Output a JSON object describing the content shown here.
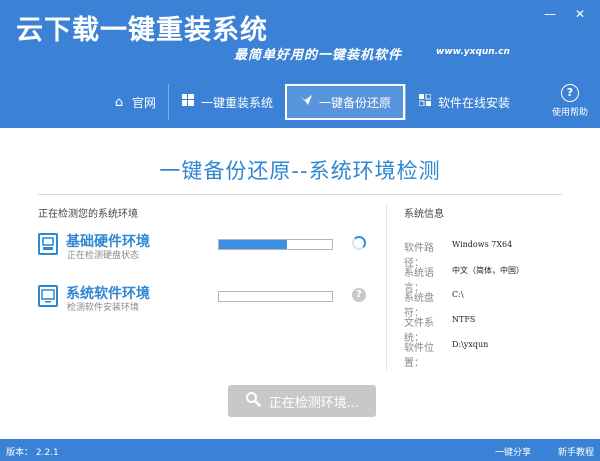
{
  "app": {
    "title": "云下载一键重装系统",
    "slogan": "最简单好用的一键装机软件",
    "site": "www.yxqun.cn"
  },
  "window_controls": {
    "minimize": "—",
    "close": "✕"
  },
  "tabs": [
    {
      "label": "官网",
      "icon": "home-icon"
    },
    {
      "label": "一键重装系统",
      "icon": "windows-icon"
    },
    {
      "label": "一键备份还原",
      "icon": "bird-icon",
      "active": true
    },
    {
      "label": "软件在线安装",
      "icon": "package-icon"
    }
  ],
  "help": {
    "label": "使用帮助",
    "icon": "?"
  },
  "main": {
    "title": "一键备份还原--系统环境检测",
    "left_section_title": "正在检测您的系统环境",
    "right_section_title": "系统信息",
    "checks": [
      {
        "title": "基础硬件环境",
        "subtitle": "正在检测硬盘状态",
        "progress": 0.6,
        "status": "loading"
      },
      {
        "title": "系统软件环境",
        "subtitle": "检测软件安装环境",
        "progress": 0,
        "status": "pending",
        "status_glyph": "?"
      }
    ],
    "info": [
      {
        "label": "软件路径：",
        "value": "Windows 7X64"
      },
      {
        "label": "系统语言：",
        "value": "中文（简体，中国）"
      },
      {
        "label": "系统盘符：",
        "value": "C:\\"
      },
      {
        "label": "文件系统：",
        "value": "NTFS"
      },
      {
        "label": "软件位置：",
        "value": "D:\\yxqun"
      }
    ],
    "detect_button": "正在检测环境..."
  },
  "footer": {
    "version": "版本： 2.2.1",
    "share": "一键分享",
    "tutorial": "新手教程"
  },
  "colors": {
    "accent": "#3b82d6",
    "title": "#2f86d3",
    "progress": "#3d8fe0"
  }
}
